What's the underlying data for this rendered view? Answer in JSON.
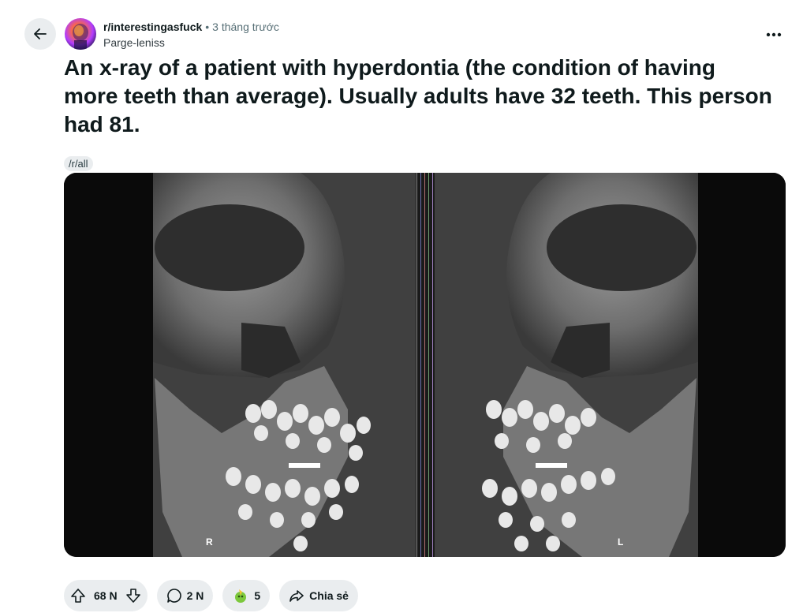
{
  "header": {
    "subreddit": "r/interestingasfuck",
    "separator": "•",
    "time_ago": "3 tháng trước",
    "author": "Parge-leniss"
  },
  "post": {
    "title": "An x-ray of a patient with hyperdontia (the condition of having more teeth than average). Usually adults have 32 teeth. This person had 81.",
    "flair": "/r/all",
    "image": {
      "left_label": "R",
      "right_label": "L"
    }
  },
  "actions": {
    "upvotes": "68 N",
    "comments": "2 N",
    "awards": "5",
    "share": "Chia sẻ"
  },
  "icons": [
    "back-arrow-icon",
    "more-icon",
    "upvote-icon",
    "downvote-icon",
    "comment-icon",
    "award-icon",
    "share-icon"
  ]
}
